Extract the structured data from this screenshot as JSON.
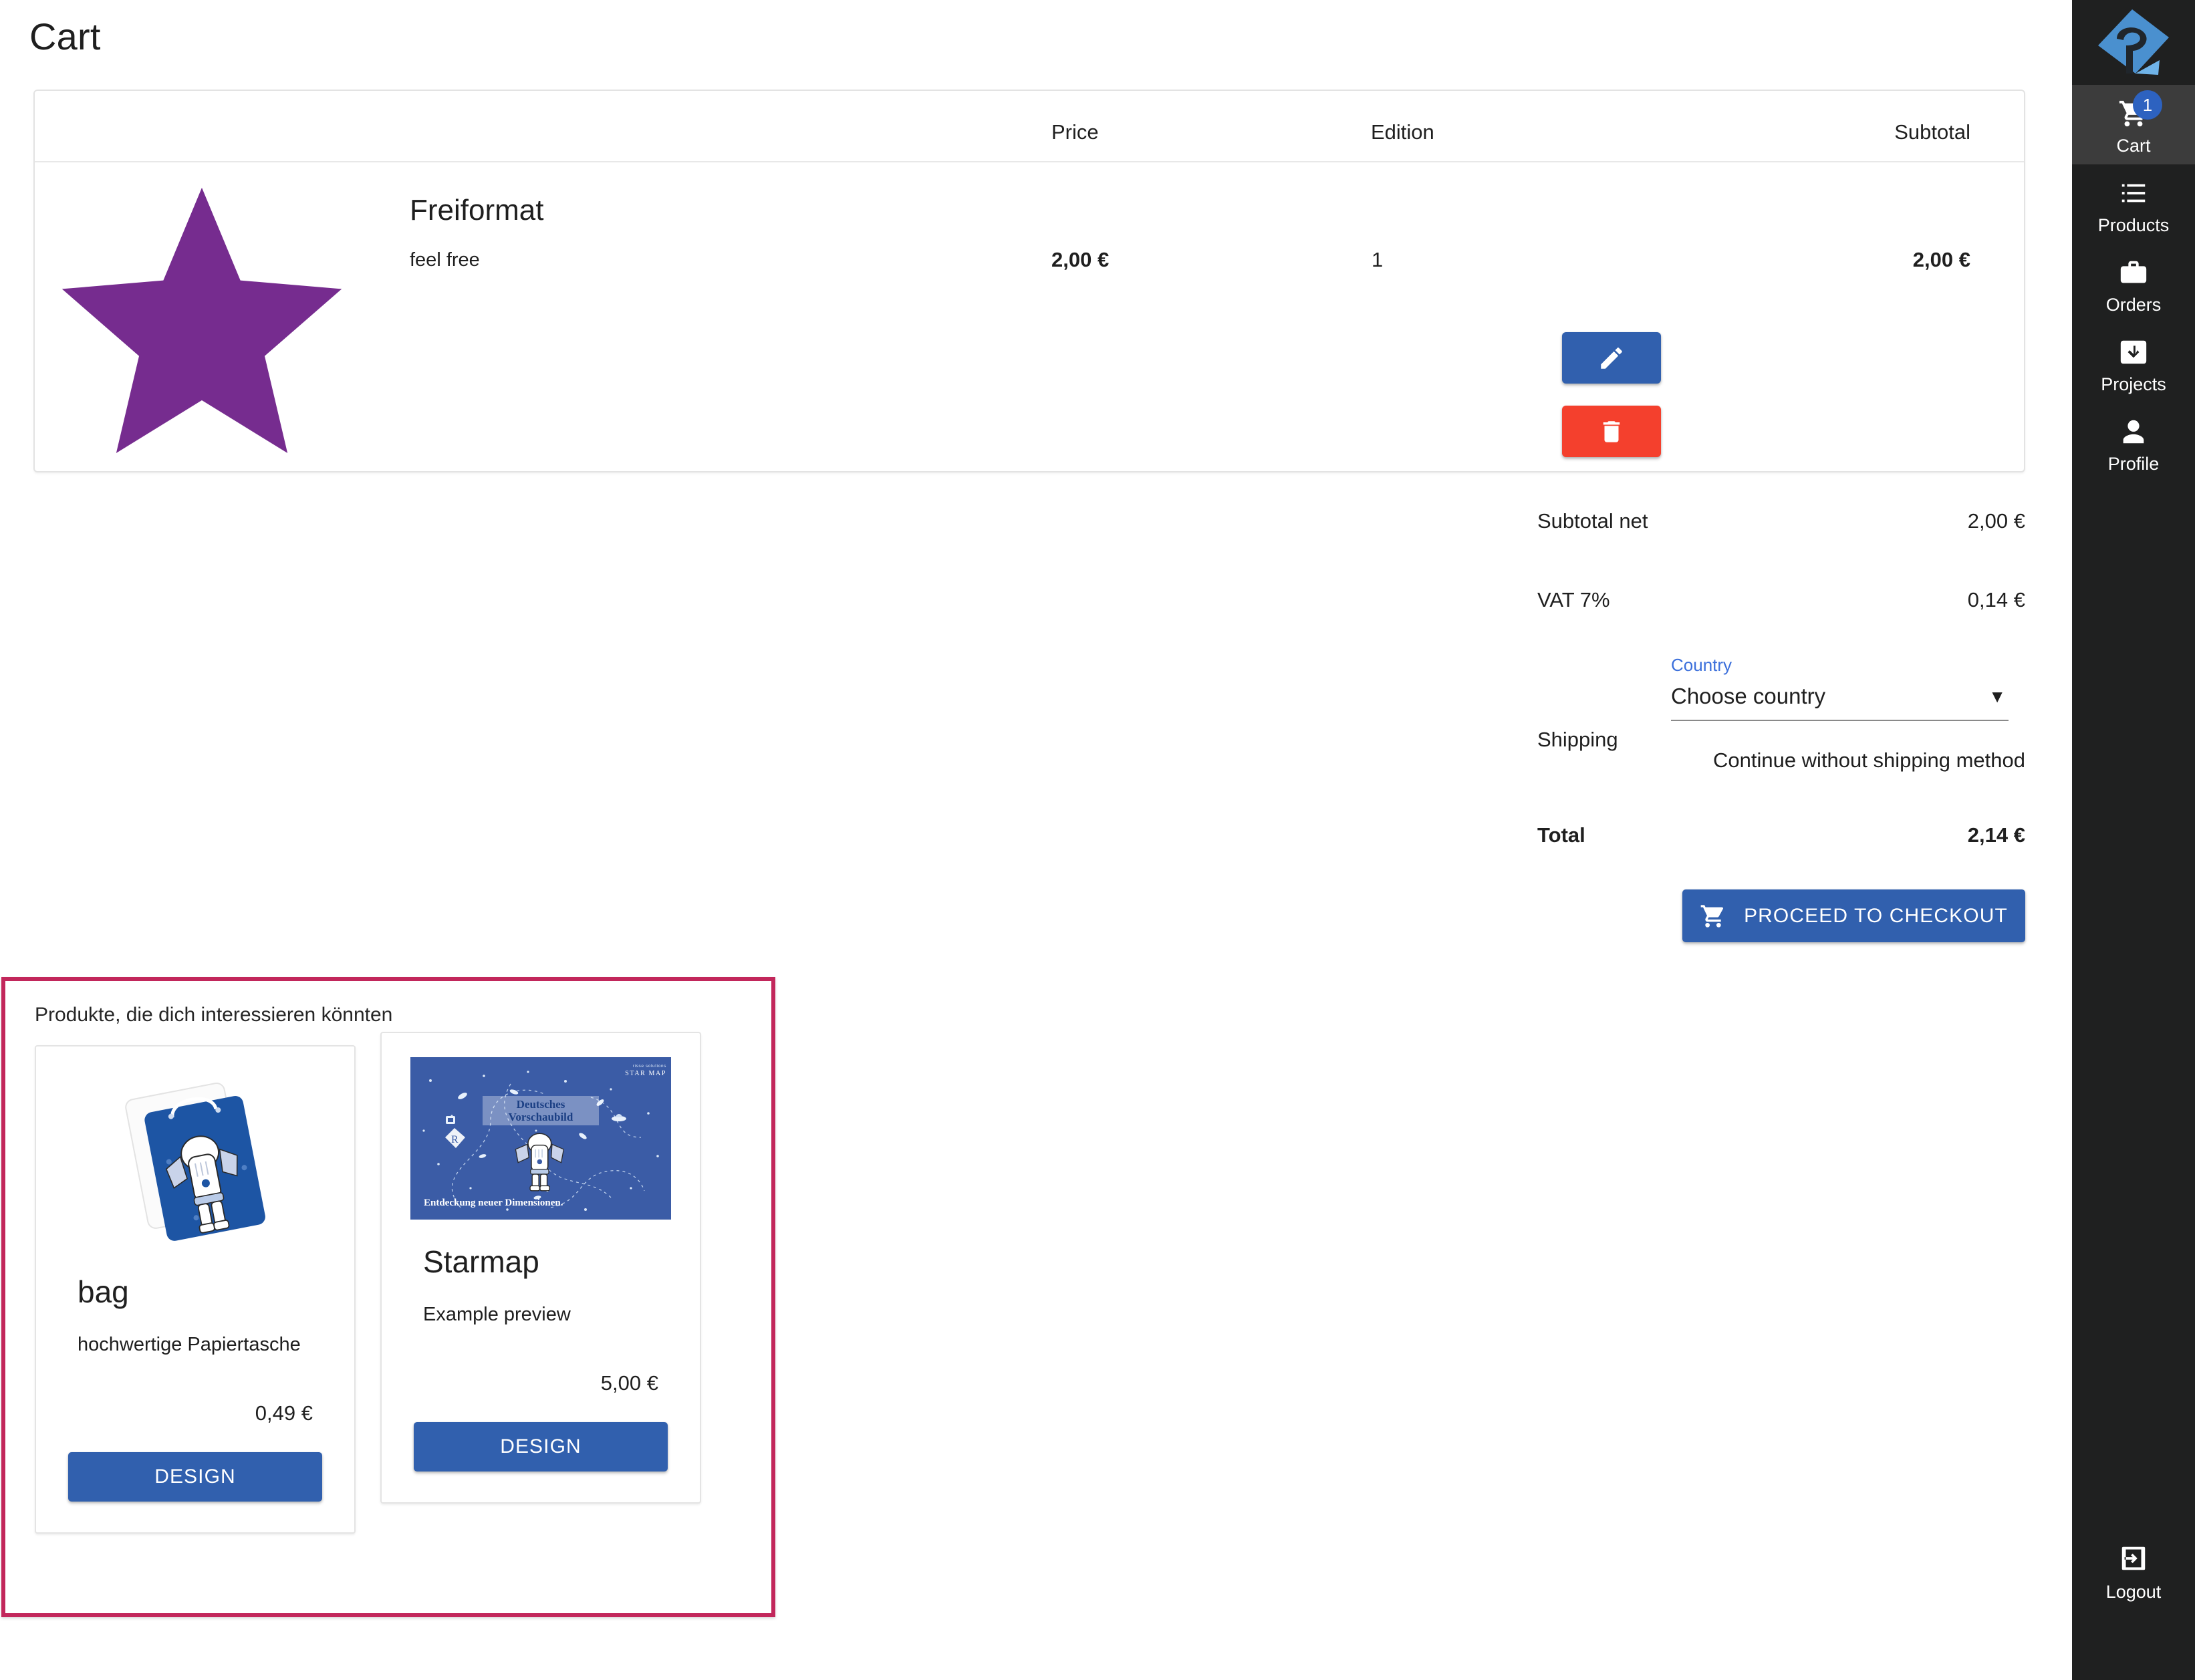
{
  "page": {
    "title": "Cart"
  },
  "cart": {
    "columns": {
      "image": "",
      "name": "",
      "price": "Price",
      "edition": "Edition",
      "actions": "",
      "subtotal": "Subtotal"
    },
    "items": [
      {
        "title": "Freiformat",
        "description": "feel free",
        "price": "2,00 €",
        "edition": "1",
        "subtotal": "2,00 €",
        "thumbnail": "purple-star",
        "thumbnail_color": "#762C8F",
        "edit_label": "",
        "delete_label": ""
      }
    ]
  },
  "summary": {
    "subtotal_label": "Subtotal net",
    "subtotal_value": "2,00 €",
    "vat_label": "VAT 7%",
    "vat_value": "0,14 €",
    "shipping_label": "Shipping",
    "country_caption": "Country",
    "country_selected": "Choose country",
    "shipping_note": "Continue without shipping method",
    "total_label": "Total",
    "total_value": "2,14 €",
    "checkout_label": "PROCEED TO CHECKOUT"
  },
  "recommendations": {
    "title": "Produkte, die dich interessieren könnten",
    "highlight_color": "#C2275B",
    "products": [
      {
        "name": "bag",
        "description": "hochwertige Papiertasche",
        "price": "0,49 €",
        "button_label": "DESIGN",
        "image": "paper-bag-blue-astronaut"
      },
      {
        "name": "Starmap",
        "description": "Example preview",
        "price": "5,00 €",
        "button_label": "DESIGN",
        "image": "starmap-preview",
        "image_texts": {
          "brand_small": "risse solutions",
          "brand_big": "STAR MAP",
          "overlay_line1": "Deutsches",
          "overlay_line2": "Vorschaubild",
          "tagline": "Entdeckung neuer Dimensionen."
        }
      }
    ]
  },
  "sidebar": {
    "logo": "risse-logo",
    "items": [
      {
        "label": "Cart",
        "icon": "shopping-cart-icon",
        "badge": "1",
        "active": true
      },
      {
        "label": "Products",
        "icon": "list-icon",
        "badge": "",
        "active": false
      },
      {
        "label": "Orders",
        "icon": "briefcase-icon",
        "badge": "",
        "active": false
      },
      {
        "label": "Projects",
        "icon": "inbox-download-icon",
        "badge": "",
        "active": false
      },
      {
        "label": "Profile",
        "icon": "person-icon",
        "badge": "",
        "active": false
      }
    ],
    "logout": {
      "label": "Logout",
      "icon": "logout-icon"
    }
  },
  "colors": {
    "primary_blue": "#3160AE",
    "danger_red": "#F4402D",
    "badge_blue": "#2D62C0",
    "sidebar_bg": "#1F2020",
    "sidebar_active": "#3C3C3C",
    "link_blue": "#3B6FDB",
    "highlight_pink": "#C2275B",
    "star_purple": "#762C8F"
  }
}
